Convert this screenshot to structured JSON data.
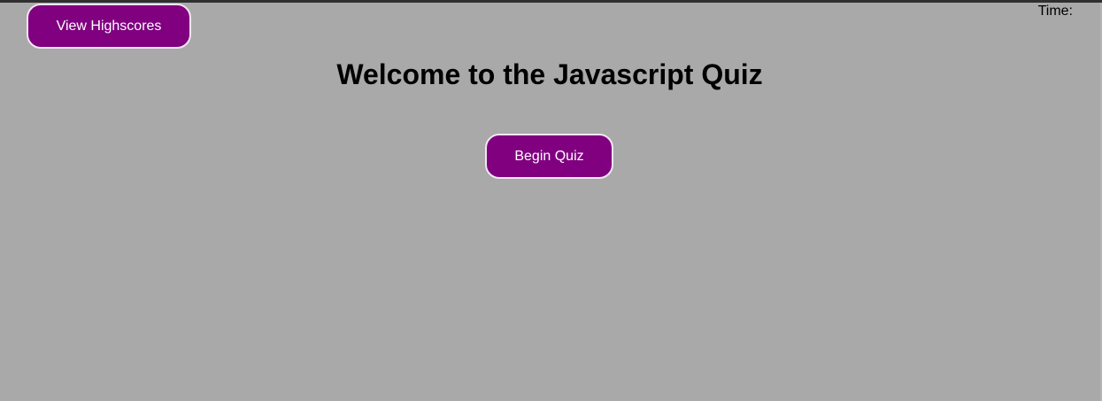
{
  "header": {
    "highscores_label": "View Highscores",
    "timer_label": "Time:"
  },
  "main": {
    "title": "Welcome to the Javascript Quiz",
    "begin_label": "Begin Quiz"
  },
  "colors": {
    "background": "#a9a9a9",
    "button": "#800080",
    "button_text": "#ffffff"
  }
}
